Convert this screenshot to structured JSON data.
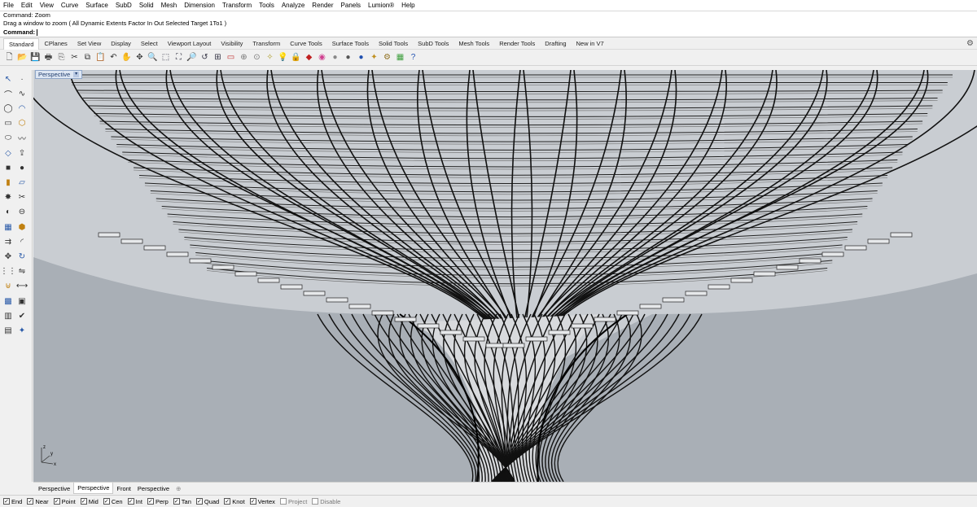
{
  "menu": [
    "File",
    "Edit",
    "View",
    "Curve",
    "Surface",
    "SubD",
    "Solid",
    "Mesh",
    "Dimension",
    "Transform",
    "Tools",
    "Analyze",
    "Render",
    "Panels",
    "Lumion®",
    "Help"
  ],
  "command": {
    "history_1": "Command: Zoom",
    "history_2": "Drag a window to zoom ( All  Dynamic  Extents  Factor  In  Out  Selected  Target  1To1 )",
    "prompt": "Command:"
  },
  "toolbar_tabs": [
    "Standard",
    "CPlanes",
    "Set View",
    "Display",
    "Select",
    "Viewport Layout",
    "Visibility",
    "Transform",
    "Curve Tools",
    "Surface Tools",
    "Solid Tools",
    "SubD Tools",
    "Mesh Tools",
    "Render Tools",
    "Drafting",
    "New in V7"
  ],
  "active_toolbar_tab": "Standard",
  "toolbar_icons": [
    {
      "name": "new-file-icon",
      "glyph": "🗋",
      "color": "#444"
    },
    {
      "name": "open-file-icon",
      "glyph": "📂",
      "color": "#c8a02a"
    },
    {
      "name": "save-icon",
      "glyph": "💾",
      "color": "#335"
    },
    {
      "name": "print-icon",
      "glyph": "🖶",
      "color": "#444"
    },
    {
      "name": "import-icon",
      "glyph": "⎘",
      "color": "#555"
    },
    {
      "name": "cut-icon",
      "glyph": "✂",
      "color": "#333"
    },
    {
      "name": "copy-icon",
      "glyph": "⧉",
      "color": "#333"
    },
    {
      "name": "paste-icon",
      "glyph": "📋",
      "color": "#b08020"
    },
    {
      "name": "undo-icon",
      "glyph": "↶",
      "color": "#333"
    },
    {
      "name": "pan-icon",
      "glyph": "✋",
      "color": "#444"
    },
    {
      "name": "rotate-view-icon",
      "glyph": "✥",
      "color": "#444"
    },
    {
      "name": "zoom-icon",
      "glyph": "🔍",
      "color": "#334"
    },
    {
      "name": "zoom-window-icon",
      "glyph": "⬚",
      "color": "#334"
    },
    {
      "name": "zoom-extents-icon",
      "glyph": "⛶",
      "color": "#334"
    },
    {
      "name": "zoom-selected-icon",
      "glyph": "🔎",
      "color": "#334"
    },
    {
      "name": "undo-view-icon",
      "glyph": "↺",
      "color": "#334"
    },
    {
      "name": "four-viewports-icon",
      "glyph": "⊞",
      "color": "#334"
    },
    {
      "name": "select-icon",
      "glyph": "▭",
      "color": "#c03030"
    },
    {
      "name": "cplane-icon",
      "glyph": "⊕",
      "color": "#777"
    },
    {
      "name": "grid-snap-icon",
      "glyph": "⊙",
      "color": "#777"
    },
    {
      "name": "properties-icon",
      "glyph": "✧",
      "color": "#b0a030"
    },
    {
      "name": "lightbulb-icon",
      "glyph": "💡",
      "color": "#777"
    },
    {
      "name": "lock-icon",
      "glyph": "🔒",
      "color": "#555"
    },
    {
      "name": "layer-icon",
      "glyph": "◆",
      "color": "#c02020"
    },
    {
      "name": "color-wheel-icon",
      "glyph": "◉",
      "color": "#d04090"
    },
    {
      "name": "shaded-icon",
      "glyph": "●",
      "color": "#888"
    },
    {
      "name": "rendered-icon",
      "glyph": "●",
      "color": "#555"
    },
    {
      "name": "render-icon",
      "glyph": "●",
      "color": "#2050b0"
    },
    {
      "name": "material-icon",
      "glyph": "✦",
      "color": "#c09020"
    },
    {
      "name": "options-gear-icon",
      "glyph": "⚙",
      "color": "#907020"
    },
    {
      "name": "plugin-icon",
      "glyph": "▦",
      "color": "#40a040"
    },
    {
      "name": "help-icon",
      "glyph": "?",
      "color": "#2050b0"
    }
  ],
  "sidebar_icons": [
    [
      "select-arrow-icon",
      "point-icon"
    ],
    [
      "polyline-icon",
      "curve-icon"
    ],
    [
      "circle-icon",
      "arc-icon"
    ],
    [
      "rectangle-tool-icon",
      "polygon-icon"
    ],
    [
      "ellipse-icon",
      "freeform-icon"
    ],
    [
      "surface-icon",
      "extrude-curve-icon"
    ],
    [
      "solid-box-icon",
      "sphere-icon"
    ],
    [
      "cylinder-icon",
      "plane-surface-icon"
    ],
    [
      "explode-icon",
      "trim-icon"
    ],
    [
      "split-icon",
      "boolean-icon"
    ],
    [
      "mesh-icon",
      "subd-icon"
    ],
    [
      "offset-icon",
      "fillet-icon"
    ],
    [
      "move-icon",
      "rotate-icon"
    ],
    [
      "array-icon",
      "mirror-icon"
    ],
    [
      "boolean-union-icon",
      "dimension-icon"
    ],
    [
      "grid-icon",
      "analyze-icon"
    ],
    [
      "block-icon",
      "check-icon"
    ],
    [
      "layer-tool-icon",
      "render-tool-icon"
    ]
  ],
  "viewport": {
    "label": "Perspective",
    "background": "#a9afb6",
    "axis_z": "z",
    "axis_x": "x",
    "axis_y": "y"
  },
  "view_tabs": [
    "Perspective",
    "Perspective",
    "Front",
    "Perspective"
  ],
  "active_view_tab": 1,
  "osnaps": [
    {
      "label": "End",
      "checked": true
    },
    {
      "label": "Near",
      "checked": true
    },
    {
      "label": "Point",
      "checked": true
    },
    {
      "label": "Mid",
      "checked": true
    },
    {
      "label": "Cen",
      "checked": true
    },
    {
      "label": "Int",
      "checked": true
    },
    {
      "label": "Perp",
      "checked": true
    },
    {
      "label": "Tan",
      "checked": true
    },
    {
      "label": "Quad",
      "checked": true
    },
    {
      "label": "Knot",
      "checked": true
    },
    {
      "label": "Vertex",
      "checked": true
    },
    {
      "label": "Project",
      "checked": false
    },
    {
      "label": "Disable",
      "checked": false
    }
  ]
}
